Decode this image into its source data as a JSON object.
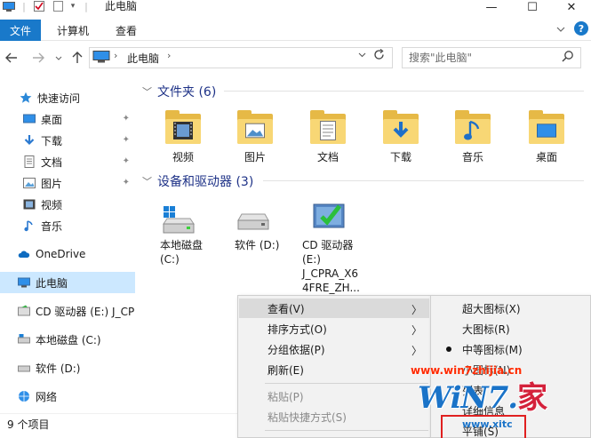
{
  "window": {
    "title": "此电脑",
    "controls": {
      "minimize": "—",
      "maximize": "☐",
      "close": "✕"
    }
  },
  "ribbon": {
    "tabs": [
      {
        "label": "文件"
      },
      {
        "label": "计算机"
      },
      {
        "label": "查看"
      }
    ],
    "help": "?"
  },
  "address": {
    "path": "此电脑",
    "search_placeholder": "搜索\"此电脑\""
  },
  "sidebar": {
    "items": [
      {
        "label": "快速访问",
        "icon": "star-icon"
      },
      {
        "label": "桌面",
        "icon": "desktop-icon",
        "pinned": true
      },
      {
        "label": "下载",
        "icon": "download-icon",
        "pinned": true
      },
      {
        "label": "文档",
        "icon": "document-icon",
        "pinned": true
      },
      {
        "label": "图片",
        "icon": "picture-icon",
        "pinned": true
      },
      {
        "label": "视频",
        "icon": "video-icon"
      },
      {
        "label": "音乐",
        "icon": "music-icon"
      },
      {
        "label": "OneDrive",
        "icon": "cloud-icon"
      },
      {
        "label": "此电脑",
        "icon": "computer-icon",
        "selected": true
      },
      {
        "label": "CD 驱动器 (E:) J_CPR",
        "icon": "cd-drive-icon"
      },
      {
        "label": "本地磁盘 (C:)",
        "icon": "disk-icon"
      },
      {
        "label": "软件 (D:)",
        "icon": "disk-icon"
      },
      {
        "label": "网络",
        "icon": "network-icon"
      }
    ]
  },
  "content": {
    "folders_group": "文件夹 (6)",
    "folders": [
      {
        "label": "视频",
        "icon": "video-folder-icon"
      },
      {
        "label": "图片",
        "icon": "picture-folder-icon"
      },
      {
        "label": "文档",
        "icon": "document-folder-icon"
      },
      {
        "label": "下载",
        "icon": "download-folder-icon"
      },
      {
        "label": "音乐",
        "icon": "music-folder-icon"
      },
      {
        "label": "桌面",
        "icon": "desktop-folder-icon"
      }
    ],
    "drives_group": "设备和驱动器 (3)",
    "drives": [
      {
        "line1": "本地磁盘",
        "line2": "(C:)"
      },
      {
        "line1": "软件 (D:)"
      },
      {
        "line1": "CD 驱动器",
        "line2": "(E:)",
        "line3": "J_CPRA_X6",
        "line4": "4FRE_ZH..."
      }
    ]
  },
  "status": {
    "text": "9 个项目"
  },
  "context_menu": {
    "items": [
      {
        "label": "查看(V)",
        "submenu": true,
        "highlighted": true
      },
      {
        "label": "排序方式(O)",
        "submenu": true
      },
      {
        "label": "分组依据(P)",
        "submenu": true
      },
      {
        "label": "刷新(E)"
      },
      {
        "label": "粘贴(P)",
        "disabled": true
      },
      {
        "label": "粘贴快捷方式(S)",
        "disabled": true
      }
    ]
  },
  "view_submenu": {
    "items": [
      {
        "label": "超大图标(X)"
      },
      {
        "label": "大图标(R)"
      },
      {
        "label": "中等图标(M)",
        "checked": true
      },
      {
        "label": "小图标(N)"
      },
      {
        "label": "列表"
      },
      {
        "label": "详细信息"
      },
      {
        "label": "平铺(S)"
      }
    ]
  },
  "watermark": {
    "url": "www.win7zhijia.cn",
    "logo": "WiN7.",
    "logo_char": "家",
    "sub": "www.xitc"
  }
}
